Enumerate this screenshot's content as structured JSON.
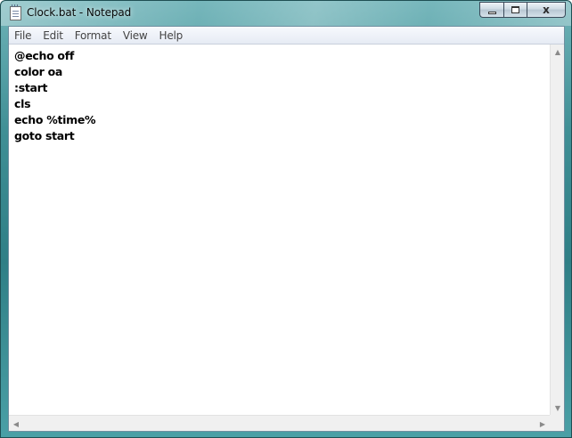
{
  "window": {
    "title": "Clock.bat - Notepad"
  },
  "caption_buttons": {
    "close": "x"
  },
  "menu": {
    "items": [
      "File",
      "Edit",
      "Format",
      "View",
      "Help"
    ]
  },
  "editor": {
    "lines": [
      "@echo off",
      "color oa",
      ":start",
      "cls",
      "echo %time%",
      "goto start"
    ]
  },
  "scrollbars": {
    "up": "▲",
    "down": "▼",
    "left": "◀",
    "right": "▶"
  },
  "icons": {
    "app": "notepad-icon",
    "minimize": "minimize-icon",
    "maximize": "maximize-icon",
    "close": "close-icon"
  }
}
